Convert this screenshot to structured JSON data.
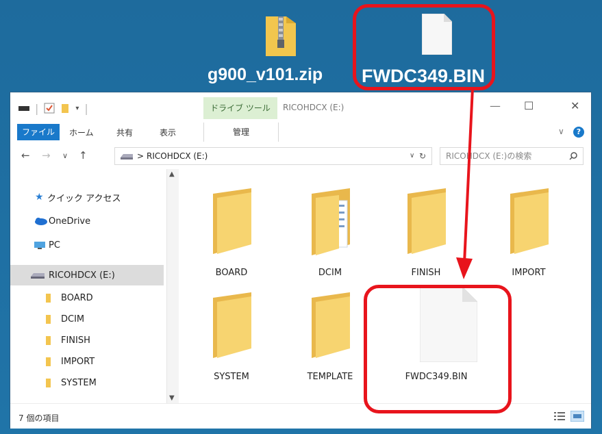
{
  "desktop": {
    "zip_label": "g900_v101.zip",
    "bin_label": "FWDC349.BIN"
  },
  "window": {
    "qat_icons": [
      "save-icon",
      "properties-icon",
      "new-folder-icon",
      "dropdown-icon"
    ],
    "tool_tab_label": "ドライブ ツール",
    "title": "RICOHDCX (E:)",
    "controls": {
      "minimize": "—",
      "maximize": "☐",
      "close": "✕"
    },
    "ribbon": {
      "file": "ファイル",
      "home": "ホーム",
      "share": "共有",
      "view": "表示",
      "manage": "管理",
      "help": "?"
    },
    "address": {
      "separator": ">",
      "path": "RICOHDCX (E:)",
      "search_placeholder": "RICOHDCX (E:)の検索"
    },
    "nav": {
      "quick_access": "クイック アクセス",
      "onedrive": "OneDrive",
      "pc": "PC",
      "drive": "RICOHDCX (E:)",
      "folders": [
        "BOARD",
        "DCIM",
        "FINISH",
        "IMPORT",
        "SYSTEM"
      ]
    },
    "content": {
      "items": [
        "BOARD",
        "DCIM",
        "FINISH",
        "IMPORT",
        "SYSTEM",
        "TEMPLATE",
        "FWDC349.BIN"
      ]
    },
    "status": "7 個の項目"
  },
  "colors": {
    "desktop": "#1f6fa1",
    "annotation": "#e8141c",
    "accent": "#1979ca",
    "folder": "#f5cd62"
  }
}
